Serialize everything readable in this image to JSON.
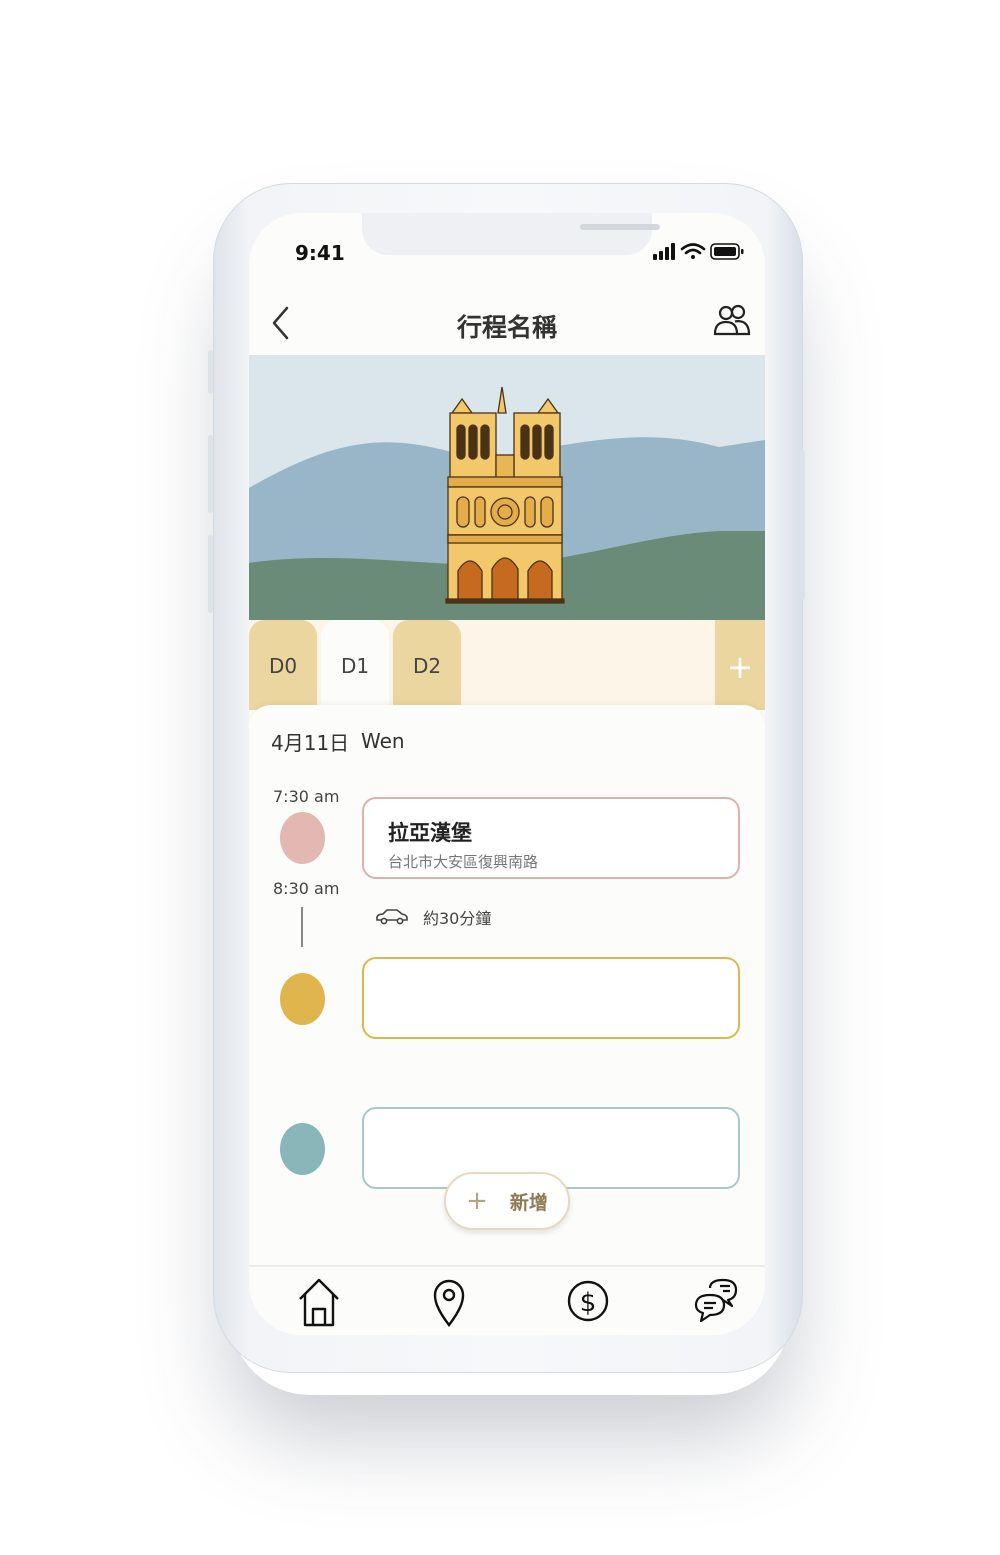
{
  "status_bar": {
    "time": "9:41"
  },
  "header": {
    "title": "行程名稱",
    "back_icon": "chevron-left-icon",
    "members_icon": "people-icon"
  },
  "hero": {
    "image": "notre-dame-cathedral-illustration"
  },
  "day_tabs": {
    "tabs": [
      {
        "label": "D0",
        "active": false
      },
      {
        "label": "D1",
        "active": true
      },
      {
        "label": "D2",
        "active": false
      }
    ],
    "add_label": "+"
  },
  "day": {
    "date": "4月11日",
    "weekday": "Wen"
  },
  "schedule": {
    "items": [
      {
        "time": "7:30 am",
        "title": "拉亞漢堡",
        "address": "台北市大安區復興南路",
        "color": "#e3b8b2"
      },
      {
        "time": "8:30 am",
        "title": "",
        "address": "",
        "color": "#e0b54e"
      },
      {
        "time": "",
        "title": "",
        "address": "",
        "color": "#89b6b8"
      }
    ],
    "travel": {
      "icon": "car-icon",
      "duration": "約30分鐘"
    }
  },
  "add_button": {
    "plus": "+",
    "label": "新增"
  },
  "bottom_nav": {
    "items": [
      {
        "icon": "home-icon"
      },
      {
        "icon": "map-pin-icon"
      },
      {
        "icon": "dollar-icon"
      },
      {
        "icon": "chat-icon"
      }
    ]
  },
  "colors": {
    "tab_inactive": "#ecd6a0",
    "tab_bar": "#fdf5e7",
    "sky": "#dae6ec",
    "hill_blue": "#98b6c8",
    "hill_green": "#6b8b79"
  }
}
